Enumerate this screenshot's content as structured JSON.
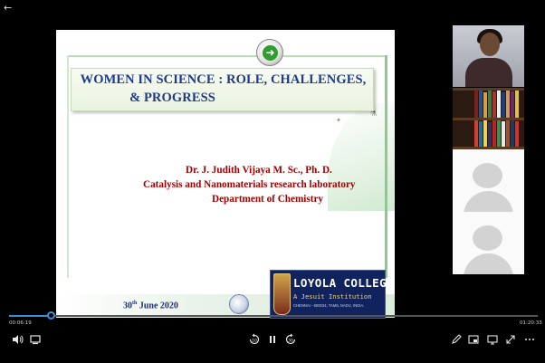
{
  "topbar": {
    "back_icon": "back-arrow-icon"
  },
  "slide": {
    "title_line1": "WOMEN IN SCIENCE : ROLE, CHALLENGES,",
    "title_line2": "& PROGRESS",
    "author_name": "Dr. J. Judith Vijaya M. Sc., Ph. D.",
    "author_lab": "Catalysis and Nanomaterials research laboratory",
    "author_dept": "Department of Chemistry",
    "date_day": "30",
    "date_suffix": "th",
    "date_rest": " June 2020",
    "college": {
      "name": "LOYOLA COLLEGE",
      "motto": "A Jesuit Institution",
      "address": "CHENNAI - 600034, TAMIL NADU, INDIA."
    }
  },
  "participants": [
    {
      "type": "video"
    },
    {
      "type": "video-bookshelf"
    },
    {
      "type": "avatar-placeholder"
    },
    {
      "type": "avatar-placeholder"
    }
  ],
  "player": {
    "elapsed": "00:06:19",
    "total": "01:20:33",
    "progress_fraction": 0.078,
    "accent": "#3a8fd9"
  }
}
